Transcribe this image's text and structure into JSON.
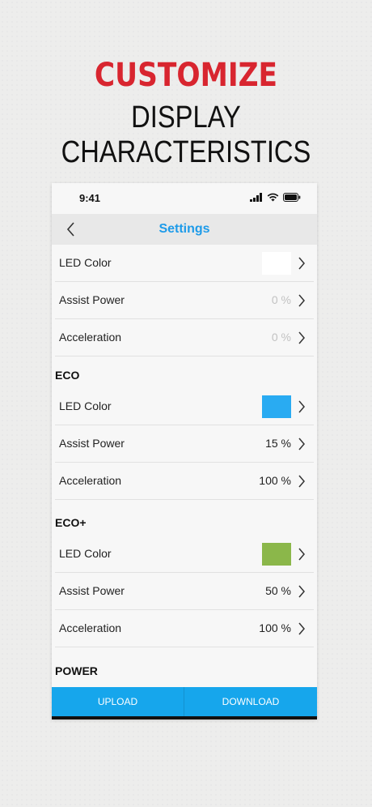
{
  "promo": {
    "headline": "CUSTOMIZE",
    "subheadline": "DISPLAY CHARACTERISTICS"
  },
  "status_bar": {
    "time": "9:41",
    "icons": [
      "signal-icon",
      "wifi-icon",
      "battery-icon"
    ]
  },
  "nav": {
    "title": "Settings",
    "back_icon": "chevron-left-icon"
  },
  "settings": {
    "top_group": {
      "led_color_label": "LED Color",
      "led_color": "#ffffff",
      "assist_power_label": "Assist Power",
      "assist_power_value": "0 %",
      "acceleration_label": "Acceleration",
      "acceleration_value": "0 %"
    },
    "eco": {
      "title": "ECO",
      "led_color_label": "LED Color",
      "led_color": "#29abf2",
      "assist_power_label": "Assist Power",
      "assist_power_value": "15 %",
      "acceleration_label": "Acceleration",
      "acceleration_value": "100 %"
    },
    "eco_plus": {
      "title": "ECO+",
      "led_color_label": "LED Color",
      "led_color": "#8bb74a",
      "assist_power_label": "Assist Power",
      "assist_power_value": "50 %",
      "acceleration_label": "Acceleration",
      "acceleration_value": "100 %"
    },
    "power": {
      "title": "POWER"
    }
  },
  "actions": {
    "upload_label": "UPLOAD",
    "download_label": "DOWNLOAD"
  },
  "colors": {
    "accent": "#1e9be9",
    "button_bg": "#16a6ec",
    "headline_red": "#d8252f"
  }
}
